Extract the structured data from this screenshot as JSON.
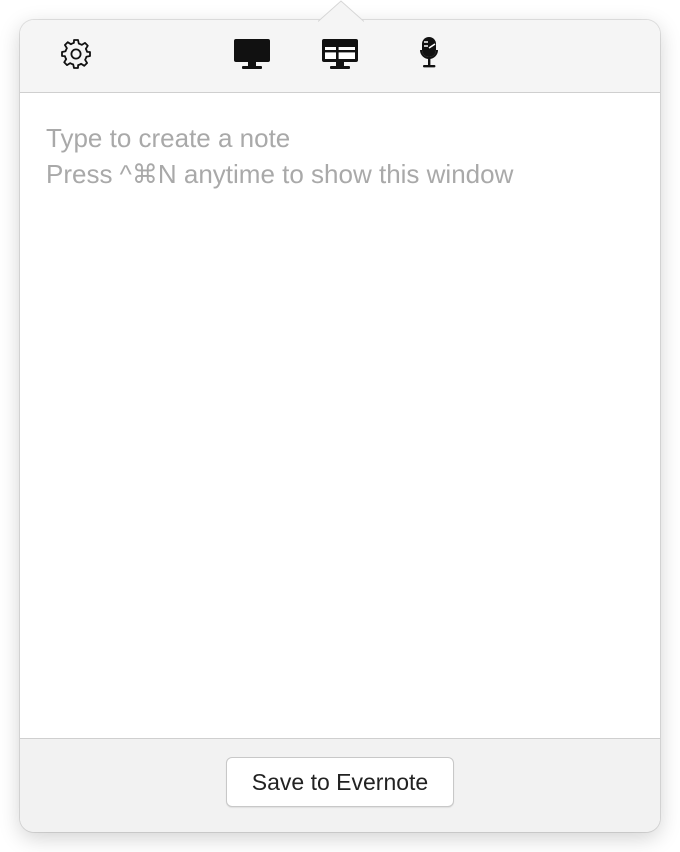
{
  "toolbar": {
    "icons": [
      "gear-icon",
      "monitor-icon",
      "region-capture-icon",
      "microphone-icon"
    ]
  },
  "editor": {
    "placeholder_line1": "Type to create a note",
    "placeholder_line2": "Press ^⌘N anytime to show this window"
  },
  "footer": {
    "save_label": "Save to Evernote"
  },
  "colors": {
    "toolbar_bg": "#f5f5f5",
    "footer_bg": "#f2f2f2",
    "placeholder": "#a9a9a9",
    "icon": "#111111"
  }
}
